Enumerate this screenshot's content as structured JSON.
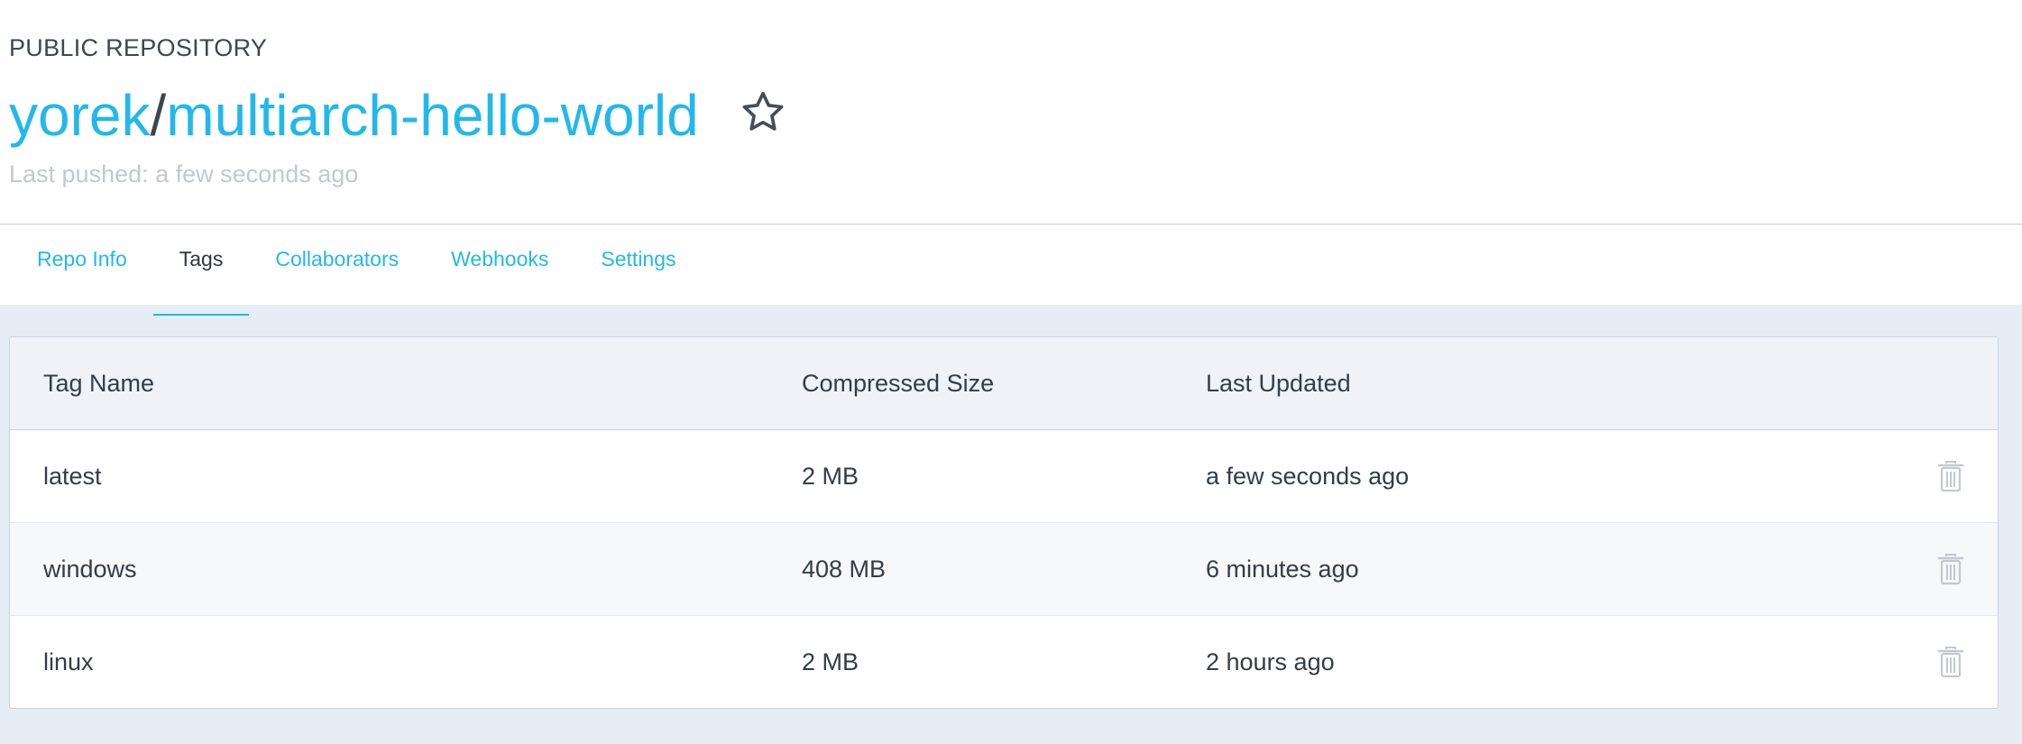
{
  "repo": {
    "visibility": "PUBLIC REPOSITORY",
    "namespace": "yorek",
    "separator": "/",
    "name": "multiarch-hello-world",
    "last_pushed": "Last pushed: a few seconds ago"
  },
  "tabs": [
    {
      "label": "Repo Info",
      "active": false
    },
    {
      "label": "Tags",
      "active": true
    },
    {
      "label": "Collaborators",
      "active": false
    },
    {
      "label": "Webhooks",
      "active": false
    },
    {
      "label": "Settings",
      "active": false
    }
  ],
  "table": {
    "headers": [
      "Tag Name",
      "Compressed Size",
      "Last Updated"
    ],
    "rows": [
      {
        "tag": "latest",
        "size": "2 MB",
        "updated": "a few seconds ago"
      },
      {
        "tag": "windows",
        "size": "408 MB",
        "updated": "6 minutes ago"
      },
      {
        "tag": "linux",
        "size": "2 MB",
        "updated": "2 hours ago"
      }
    ]
  },
  "icons": {
    "star": "star-outline-icon",
    "delete": "trash-icon"
  },
  "colors": {
    "accent": "#22b8eb",
    "text": "#333d47",
    "muted": "#c3c8cf",
    "background": "#e5edf5"
  }
}
